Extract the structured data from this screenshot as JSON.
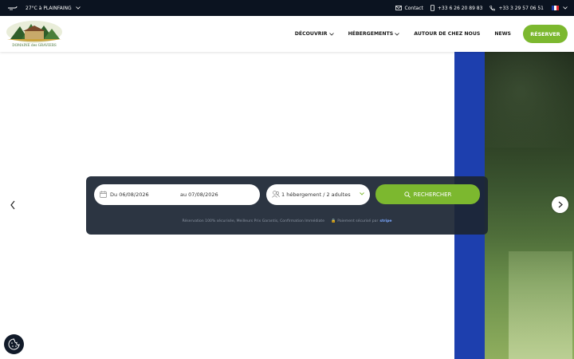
{
  "topbar": {
    "weather_icon": "wind-icon",
    "weather": "27°C à PLAINFAING",
    "contact_label": "Contact",
    "phone_mobile": "+33 6 26 20 89 83",
    "phone_fixed": "+33 3 29 57 06 51",
    "language": "fr"
  },
  "header": {
    "logo_text": "DOMAINE des GRAVIERS",
    "nav": [
      "DÉCOUVRIR",
      "HÉBERGEMENTS",
      "AUTOUR DE CHEZ NOUS",
      "NEWS"
    ],
    "reserve_label": "RÉSERVER"
  },
  "search": {
    "date_from": "Du 06/08/2026",
    "date_to": "au 07/08/2026",
    "guests": "1 hébergement / 2 adultes",
    "button_label": "RECHERCHER",
    "trust_text": "Réservation 100% sécurisée, Meilleurs Prix Garantis, Confirmation Immédiate",
    "payment_text": "Paiement sécurisé par",
    "payment_brand": "stripe"
  },
  "colors": {
    "accent_green": "#7cb82f",
    "topbar_bg": "#0b1320",
    "panel_bg": "#1c2634",
    "band_blue": "#1d3fae"
  }
}
